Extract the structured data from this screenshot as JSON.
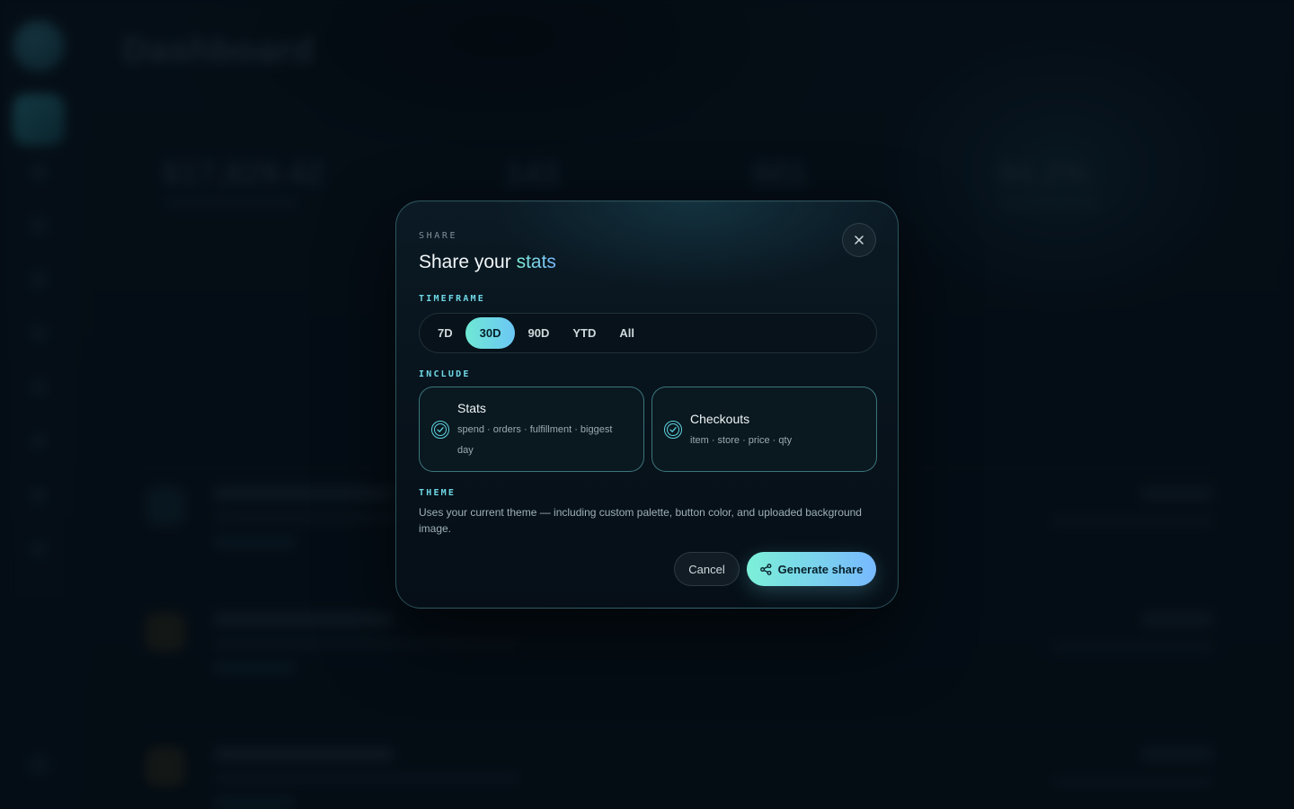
{
  "background": {
    "page_title": "Dashboard",
    "stats": [
      "$17,829.42",
      "143",
      "601",
      "94.2%"
    ]
  },
  "modal": {
    "eyebrow": "SHARE",
    "title_prefix": "Share your ",
    "title_accent": "stats",
    "close_icon": "close-icon",
    "timeframe": {
      "label": "TIMEFRAME",
      "options": [
        "7D",
        "30D",
        "90D",
        "YTD",
        "All"
      ],
      "selected": "30D"
    },
    "include": {
      "label": "INCLUDE",
      "cards": [
        {
          "title": "Stats",
          "subtitle": "spend · orders · fulfillment · biggest day",
          "checked": true
        },
        {
          "title": "Checkouts",
          "subtitle": "item · store · price · qty",
          "checked": true
        }
      ]
    },
    "theme": {
      "label": "THEME",
      "description": "Uses your current theme — including custom palette, button color, and uploaded background image."
    },
    "actions": {
      "cancel_label": "Cancel",
      "generate_label": "Generate share",
      "generate_icon": "share-icon"
    }
  },
  "colors": {
    "accent_start": "#7cf0d8",
    "accent_end": "#78b9ff",
    "card_border": "#5fd3df"
  }
}
